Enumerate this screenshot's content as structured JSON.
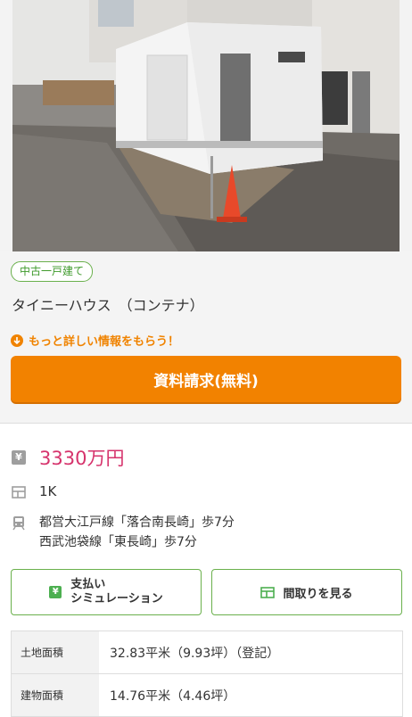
{
  "photo": {
    "alt_icon": "container-house-photo"
  },
  "listing": {
    "badge": "中古一戸建て",
    "title": "タイニーハウス　（コンテナ）",
    "more_info_link": "もっと詳しい情報をもらう！",
    "request_button": "資料請求(無料)"
  },
  "details": {
    "price_icon": "¥",
    "price": "3330万円",
    "layout": "1K",
    "stations": [
      "都営大江戸線「落合南長崎」歩7分",
      "西武池袋線「東長崎」歩7分"
    ]
  },
  "actions": {
    "payment_line1": "支払い",
    "payment_line2": "シミュレーション",
    "floorplan": "間取りを見る"
  },
  "table": {
    "rows": [
      {
        "label": "土地面積",
        "value": "32.83平米（9.93坪）（登記）"
      },
      {
        "label": "建物面積",
        "value": "14.76平米（4.46坪）"
      }
    ]
  },
  "colors": {
    "accent_orange": "#f28200",
    "green": "#6ab04c",
    "price_pink": "#d6336c"
  }
}
